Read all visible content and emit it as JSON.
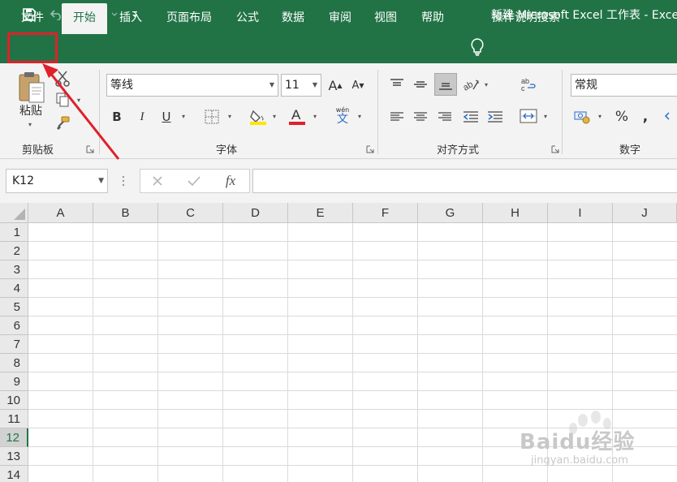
{
  "window": {
    "title": "新建 Microsoft Excel 工作表 - Excel"
  },
  "quick_access": {
    "save_icon": "save-icon",
    "undo_icon": "undo-icon",
    "redo_icon": "redo-icon",
    "customize_icon": "customize-qat-icon"
  },
  "tabs": [
    {
      "label": "文件"
    },
    {
      "label": "开始"
    },
    {
      "label": "插入"
    },
    {
      "label": "页面布局"
    },
    {
      "label": "公式"
    },
    {
      "label": "数据"
    },
    {
      "label": "审阅"
    },
    {
      "label": "视图"
    },
    {
      "label": "帮助"
    }
  ],
  "tell_me": {
    "label": "操作说明搜索"
  },
  "ribbon": {
    "clipboard": {
      "label": "剪贴板",
      "paste_label": "粘贴"
    },
    "font": {
      "label": "字体",
      "font_name": "等线",
      "font_size": "11",
      "phonetic_label": "wén"
    },
    "alignment": {
      "label": "对齐方式"
    },
    "number": {
      "label": "数字",
      "format": "常规"
    }
  },
  "formula_bar": {
    "name_box": "K12",
    "fx_label": "fx",
    "value": ""
  },
  "sheet": {
    "columns": [
      "A",
      "B",
      "C",
      "D",
      "E",
      "F",
      "G",
      "H",
      "I",
      "J"
    ],
    "rows": [
      "1",
      "2",
      "3",
      "4",
      "5",
      "6",
      "7",
      "8",
      "9",
      "10",
      "11",
      "12",
      "13",
      "14"
    ],
    "selected_row": "12"
  },
  "colors": {
    "brand": "#217346",
    "highlight_box": "#e0202a",
    "font_color_bar": "#e0202a",
    "fill_color_bar": "#ffe600"
  },
  "watermark": {
    "text": "Baidu经验",
    "url": "jingyan.baidu.com"
  }
}
